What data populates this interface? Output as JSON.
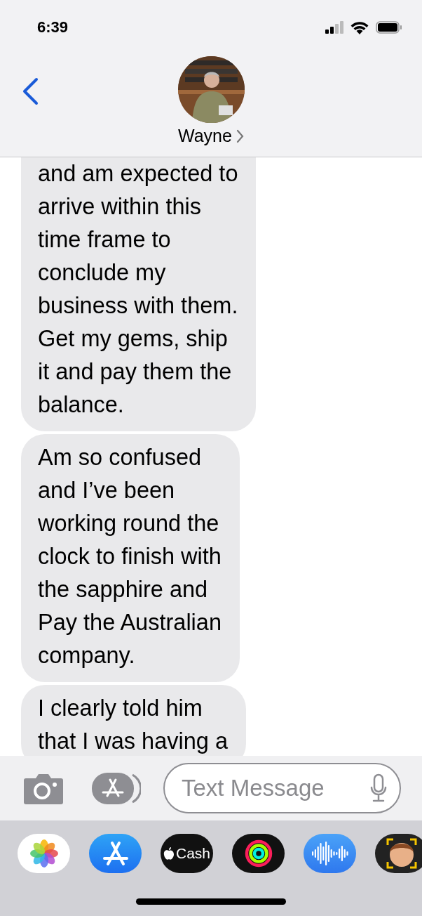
{
  "status_bar": {
    "time": "6:39"
  },
  "header": {
    "contact_name": "Wayne"
  },
  "messages": [
    {
      "text": "and am expected to\narrive within this\ntime frame to\nconclude my\nbusiness with them.\nGet my gems, ship\nit and pay them the\nbalance."
    },
    {
      "text": "Am so confused\nand I’ve been\nworking round the\nclock to finish with\nthe sapphire and\nPay the Australian\ncompany."
    },
    {
      "text": "I clearly told him\nthat I was having a"
    }
  ],
  "composer": {
    "placeholder": "Text Message"
  },
  "app_drawer": [
    {
      "kind": "photos"
    },
    {
      "kind": "appstore"
    },
    {
      "kind": "cash",
      "label": "Cash"
    },
    {
      "kind": "activity"
    },
    {
      "kind": "audio"
    },
    {
      "kind": "memoji"
    }
  ]
}
